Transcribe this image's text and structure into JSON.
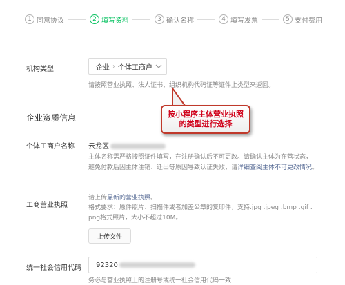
{
  "stepper": {
    "steps": [
      {
        "num": "1",
        "label": "同意协议"
      },
      {
        "num": "2",
        "label": "填写资料"
      },
      {
        "num": "3",
        "label": "确认名称"
      },
      {
        "num": "4",
        "label": "填写发票"
      },
      {
        "num": "5",
        "label": "支付费用"
      }
    ],
    "active_index": 1
  },
  "org_type": {
    "label": "机构类型",
    "select_primary": "企业",
    "select_secondary": "个体工商户",
    "hint": "请按照营业执照、法人证书、组织机构代码证等证件上类型来返回。"
  },
  "callout": {
    "line1": "按小程序主体营业执照",
    "line2": "的类型进行选择"
  },
  "qualification": {
    "title": "企业资质信息"
  },
  "account_name": {
    "label": "个体工商户名称",
    "value_prefix": "云龙区",
    "hint_line1": "主体名称需严格按照证件填写，在注册确认后不可更改。请确认主体为在营状态，",
    "hint_line2": "避免付款后因主体注销、迁出等原因导致认证失败，请",
    "hint_link": "详细查阅主体不可更改情况",
    "hint_end": "。"
  },
  "license": {
    "label": "工商营业执照",
    "upload_hint_prefix": "请上传",
    "upload_hint_link": "最新的营业执照",
    "upload_hint_suffix": "。",
    "format_line1": "格式要求：原件照片、扫描件或者加盖公章的复印件，支持.jpg .jpeg .bmp .gif .",
    "format_line2": "png格式照片，大小不超过10M。",
    "upload_button": "上传文件"
  },
  "credit_code": {
    "label": "统一社会信用代码",
    "value_prefix": "92320",
    "hint": "务必与营业执照上的注册号或统一社会信用代码一致"
  },
  "colors": {
    "accent": "#07c160",
    "callout_border": "#c0392b",
    "callout_text": "#d0021b",
    "link": "#576b95"
  }
}
